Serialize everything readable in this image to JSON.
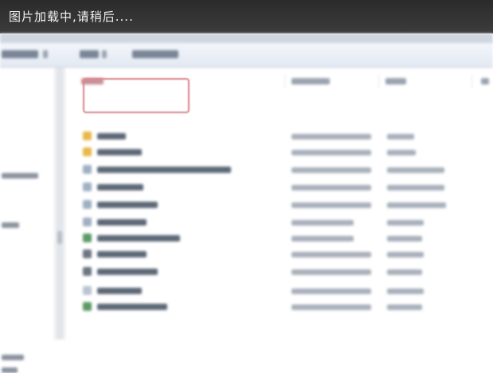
{
  "loading": {
    "message": "图片加载中,请稍后...."
  },
  "colors": {
    "loading_bar": "#333333",
    "toolbar": "#e8edf4",
    "selection_outline": "#d9848c",
    "folder_icon": "#e8b848",
    "file_icon": "#9fb0c4",
    "exe_icon": "#5a9a66"
  },
  "toolbar": {
    "items": [
      {
        "icon": "organize-menu-icon"
      },
      {
        "icon": "open-menu-icon"
      },
      {
        "icon": "new-folder-menu-icon"
      }
    ]
  },
  "nav": {
    "items": [
      {
        "icon": "nav-item-icon"
      },
      {
        "icon": "nav-item-icon"
      },
      {
        "icon": "nav-item-icon"
      },
      {
        "icon": "nav-item-icon"
      }
    ]
  },
  "files": {
    "columns": [
      {
        "icon": "name-column-icon"
      },
      {
        "icon": "date-column-icon"
      },
      {
        "icon": "type-column-icon"
      },
      {
        "icon": "size-column-icon"
      }
    ],
    "rows": [
      {
        "icon": "folder-icon"
      },
      {
        "icon": "folder-icon"
      },
      {
        "icon": "file-icon"
      },
      {
        "icon": "file-icon"
      },
      {
        "icon": "file-icon"
      },
      {
        "icon": "file-icon"
      },
      {
        "icon": "exe-icon"
      },
      {
        "icon": "file-icon"
      },
      {
        "icon": "file-icon"
      },
      {
        "icon": "file-icon"
      },
      {
        "icon": "exe-icon"
      }
    ]
  }
}
